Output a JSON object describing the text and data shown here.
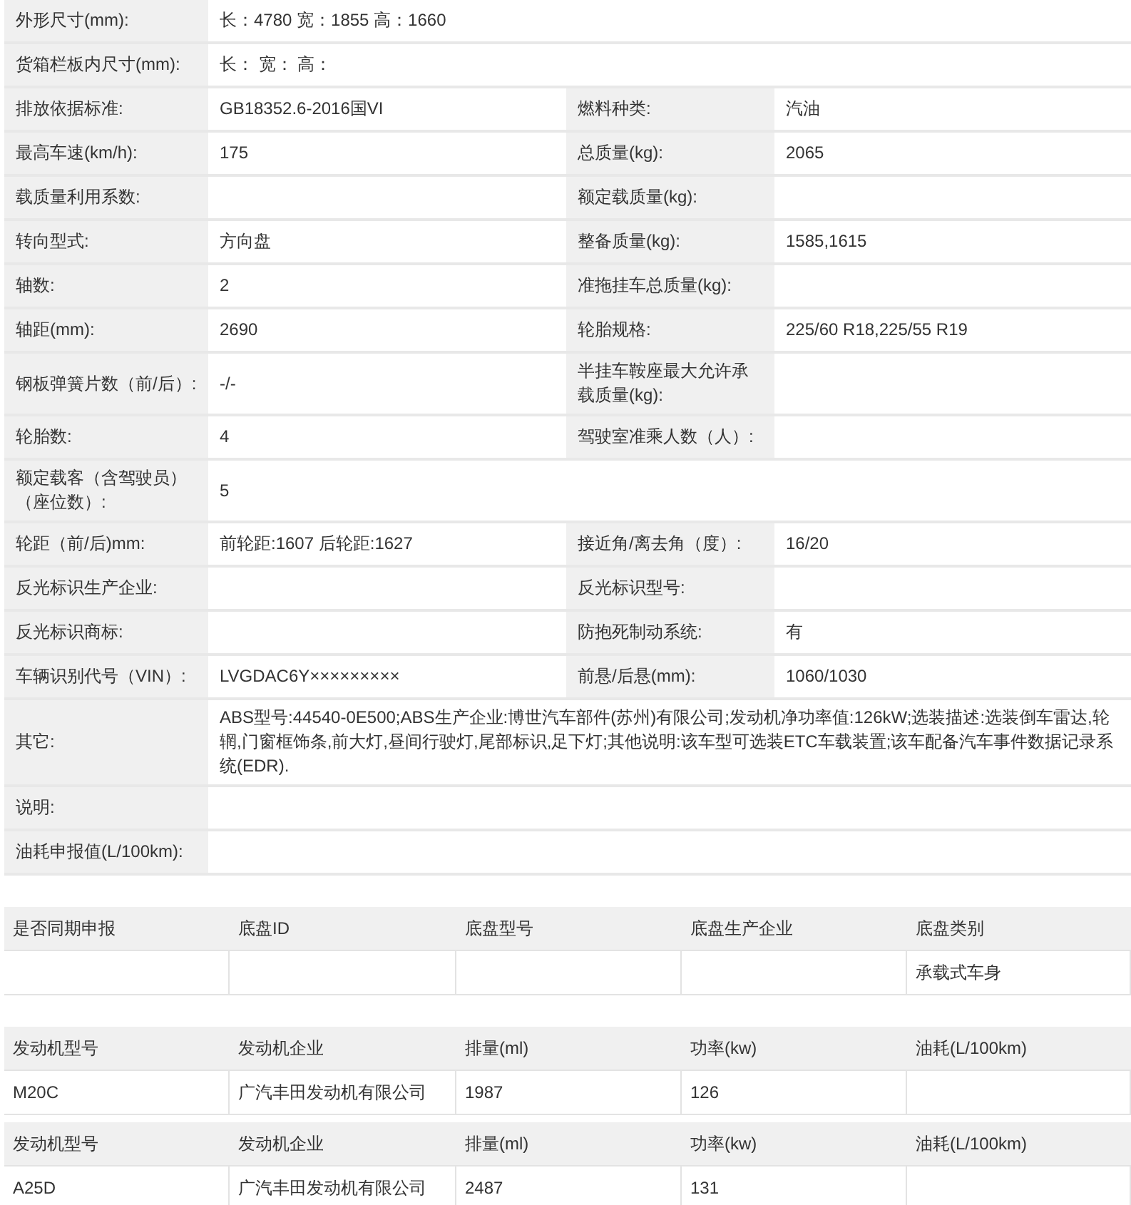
{
  "spec_table": {
    "rows": [
      {
        "fields": [
          {
            "label": "外形尺寸(mm):",
            "value": "长：4780 宽：1855 高：1660"
          }
        ]
      },
      {
        "fields": [
          {
            "label": "货箱栏板内尺寸(mm):",
            "value": "长： 宽： 高："
          }
        ]
      },
      {
        "fields": [
          {
            "label": "排放依据标准:",
            "value": "GB18352.6-2016国VI"
          },
          {
            "label": "燃料种类:",
            "value": "汽油"
          }
        ]
      },
      {
        "fields": [
          {
            "label": "最高车速(km/h):",
            "value": "175"
          },
          {
            "label": "总质量(kg):",
            "value": "2065"
          }
        ]
      },
      {
        "fields": [
          {
            "label": "载质量利用系数:"
          },
          {
            "label": "额定载质量(kg):"
          }
        ]
      },
      {
        "fields": [
          {
            "label": "转向型式:",
            "value": "方向盘"
          },
          {
            "label": "整备质量(kg):",
            "value": "1585,1615"
          }
        ]
      },
      {
        "fields": [
          {
            "label": "轴数:",
            "value": "2"
          },
          {
            "label": "准拖挂车总质量(kg):"
          }
        ]
      },
      {
        "fields": [
          {
            "label": "轴距(mm):",
            "value": "2690"
          },
          {
            "label": "轮胎规格:",
            "value": "225/60 R18,225/55 R19"
          }
        ]
      },
      {
        "fields": [
          {
            "label": "钢板弹簧片数（前/后）:",
            "value": "-/-"
          },
          {
            "label": "半挂车鞍座最大允许承载质量(kg):"
          }
        ]
      },
      {
        "fields": [
          {
            "label": "轮胎数:",
            "value": "4"
          },
          {
            "label": "驾驶室准乘人数（人）:"
          }
        ]
      },
      {
        "fields": [
          {
            "label": "额定载客（含驾驶员）（座位数）:",
            "value": "5"
          }
        ]
      },
      {
        "fields": [
          {
            "label": "轮距（前/后)mm:",
            "value": "前轮距:1607 后轮距:1627"
          },
          {
            "label": "接近角/离去角（度）:",
            "value": "16/20"
          }
        ]
      },
      {
        "fields": [
          {
            "label": "反光标识生产企业:"
          },
          {
            "label": "反光标识型号:"
          }
        ]
      },
      {
        "fields": [
          {
            "label": "反光标识商标:"
          },
          {
            "label": "防抱死制动系统:",
            "value": "有"
          }
        ]
      },
      {
        "fields": [
          {
            "label": "车辆识别代号（VIN）:",
            "value": "LVGDAC6Y×××××××××"
          },
          {
            "label": "前悬/后悬(mm):",
            "value": "1060/1030"
          }
        ]
      },
      {
        "fields": [
          {
            "label": "其它:",
            "value": "ABS型号:44540-0E500;ABS生产企业:博世汽车部件(苏州)有限公司;发动机净功率值:126kW;选装描述:选装倒车雷达,轮辋,门窗框饰条,前大灯,昼间行驶灯,尾部标识,足下灯;其他说明:该车型可选装ETC车载装置;该车配备汽车事件数据记录系统(EDR)."
          }
        ]
      },
      {
        "fields": [
          {
            "label": "说明:"
          }
        ]
      },
      {
        "fields": [
          {
            "label": "油耗申报值(L/100km):"
          }
        ]
      }
    ]
  },
  "chassis_table": {
    "columns": [
      "是否同期申报",
      "底盘ID",
      "底盘型号",
      "底盘生产企业",
      "底盘类别"
    ],
    "rows": [
      [
        "",
        "",
        "",
        "",
        "承载式车身"
      ]
    ]
  },
  "engine_tables": [
    {
      "columns": [
        "发动机型号",
        "发动机企业",
        "排量(ml)",
        "功率(kw)",
        "油耗(L/100km)"
      ],
      "rows": [
        [
          "M20C",
          "广汽丰田发动机有限公司",
          "1987",
          "126",
          ""
        ]
      ]
    },
    {
      "columns": [
        "发动机型号",
        "发动机企业",
        "排量(ml)",
        "功率(kw)",
        "油耗(L/100km)"
      ],
      "rows": [
        [
          "A25D",
          "广汽丰田发动机有限公司",
          "2487",
          "131",
          ""
        ]
      ]
    }
  ]
}
